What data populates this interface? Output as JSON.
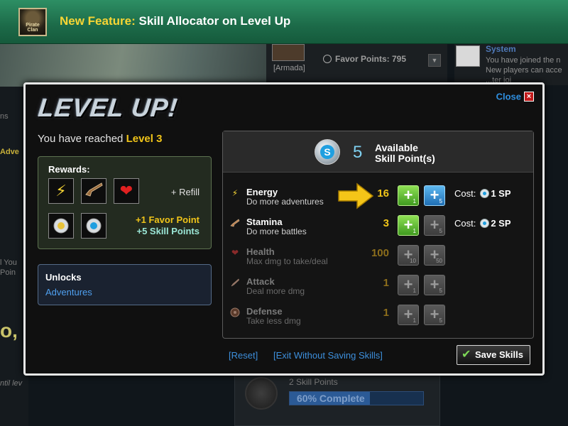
{
  "banner": {
    "logo_text": "Pirate Clan",
    "prefix": "New Feature:",
    "title": "Skill Allocator on Level Up"
  },
  "background": {
    "armada": "[Armada]",
    "favor_points": "Favor Points: 795",
    "system_title": "System",
    "system_lines": [
      "You have joined the n",
      "New players can acce",
      "...ter joi"
    ],
    "left_texts": [
      "ns",
      "Adve",
      "l You",
      "Poin",
      "o,",
      "ntil lev"
    ],
    "skill_points": "2 Skill Points",
    "progress_text": "60% Complete",
    "progress_fraction": 0.6
  },
  "modal": {
    "title": "LEVEL UP!",
    "close_label": "Close",
    "close_x": "×",
    "reached_prefix": "You have reached",
    "level": "Level 3",
    "rewards": {
      "title": "Rewards:",
      "refill": "+ Refill",
      "favor": "+1 Favor Point",
      "skill_points": "+5 Skill Points",
      "icons": [
        "lightning-icon",
        "pistol-icon",
        "heart-icon",
        "favor-coin-icon",
        "skill-coin-icon"
      ]
    },
    "unlocks": {
      "title": "Unlocks",
      "link": "Adventures"
    },
    "skills": {
      "available_count": "5",
      "available_line1": "Available",
      "available_line2": "Skill Point(s)",
      "coin_letter": "S",
      "cost_label": "Cost:",
      "rows": [
        {
          "name": "Energy",
          "desc": "Do more adventures",
          "value": "16",
          "btn1": "1",
          "btn2": "5",
          "cost": "1 SP",
          "icon": "lightning-icon",
          "active": true
        },
        {
          "name": "Stamina",
          "desc": "Do more battles",
          "value": "3",
          "btn1": "1",
          "btn2": "5",
          "cost": "2 SP",
          "icon": "pistol-icon",
          "active": true
        },
        {
          "name": "Health",
          "desc": "Max dmg to take/deal",
          "value": "100",
          "btn1": "10",
          "btn2": "50",
          "icon": "heart-icon",
          "active": false
        },
        {
          "name": "Attack",
          "desc": "Deal more dmg",
          "value": "1",
          "btn1": "1",
          "btn2": "5",
          "icon": "sword-icon",
          "active": false
        },
        {
          "name": "Defense",
          "desc": "Take less dmg",
          "value": "1",
          "btn1": "1",
          "btn2": "5",
          "icon": "shield-icon",
          "active": false
        }
      ]
    },
    "reset_label": "[Reset]",
    "exit_label": "[Exit Without Saving Skills]",
    "save_label": "Save Skills"
  }
}
